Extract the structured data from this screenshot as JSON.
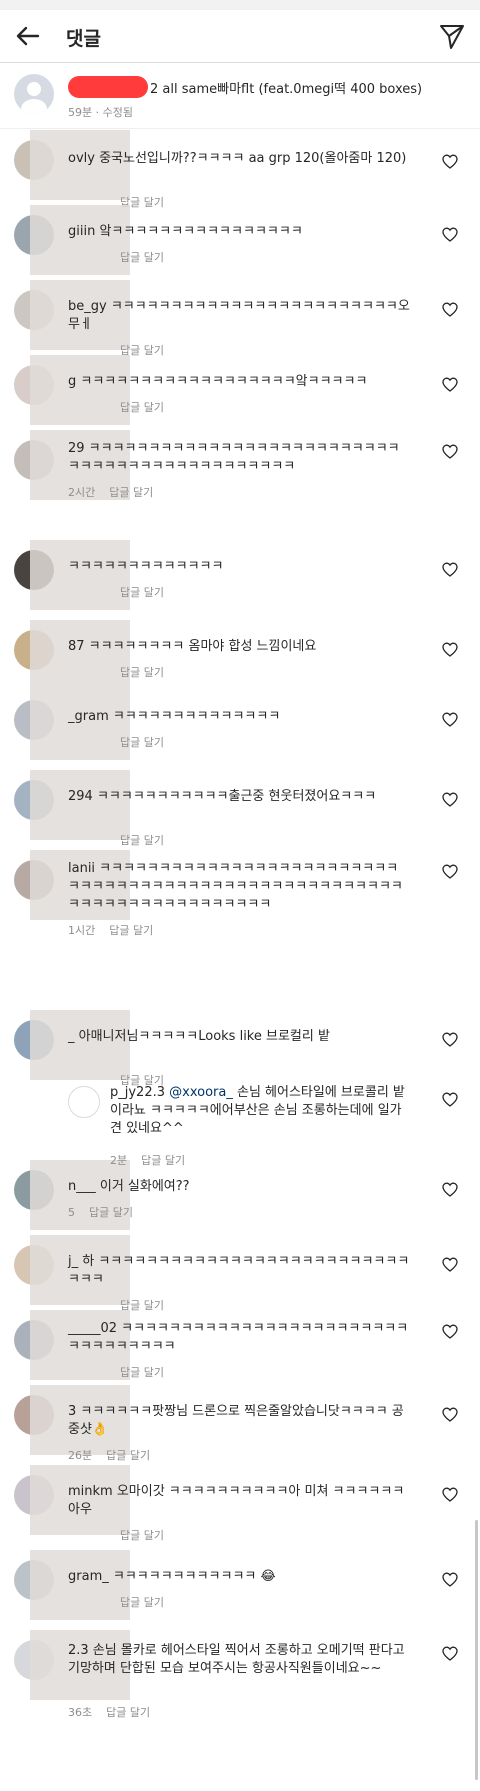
{
  "header": {
    "title": "댓글"
  },
  "caption": {
    "text": "2 all same빠마flt (feat.0megi떡 400 boxes)",
    "meta": "59분 · 수정됨"
  },
  "reply_label": "답글 달기",
  "comments": [
    {
      "text": "ovly 중국노선입니까??ㅋㅋㅋㅋ aa grp 120(올아줌마 120)",
      "time": ""
    },
    {
      "text": "giiin 앜ㅋㅋㅋㅋㅋㅋㅋㅋㅋㅋㅋㅋㅋㅋㅋㅋ",
      "time": ""
    },
    {
      "text": "be_gy ㅋㅋㅋㅋㅋㅋㅋㅋㅋㅋㅋㅋㅋㅋㅋㅋㅋㅋㅋㅋㅋㅋㅋㅋ오무ㅔ",
      "time": ""
    },
    {
      "text": "g ㅋㅋㅋㅋㅋㅋㅋㅋㅋㅋㅋㅋㅋㅋㅋㅋㅋㅋ앜ㅋㅋㅋㅋㅋ",
      "time": ""
    },
    {
      "text": "29 ㅋㅋㅋㅋㅋㅋㅋㅋㅋㅋㅋㅋㅋㅋㅋㅋㅋㅋㅋㅋㅋㅋㅋㅋㅋㅋㅋㅋㅋㅋㅋㅋㅋㅋㅋㅋㅋㅋㅋㅋㅋㅋㅋㅋㅋ",
      "time": "2시간"
    },
    {
      "text": "ㅋㅋㅋㅋㅋㅋㅋㅋㅋㅋㅋㅋㅋ",
      "time": ""
    },
    {
      "text": "87 ㅋㅋㅋㅋㅋㅋㅋㅋ 옴마야 합성 느낌이네요",
      "time": ""
    },
    {
      "text": "_gram ㅋㅋㅋㅋㅋㅋㅋㅋㅋㅋㅋㅋㅋㅋ",
      "time": ""
    },
    {
      "text": "294 ㅋㅋㅋㅋㅋㅋㅋㅋㅋㅋㅋ출근중 현웃터졌어요ㅋㅋㅋ",
      "time": ""
    },
    {
      "text": "lanii ㅋㅋㅋㅋㅋㅋㅋㅋㅋㅋㅋㅋㅋㅋㅋㅋㅋㅋㅋㅋㅋㅋㅋㅋㅋㅋㅋㅋㅋㅋㅋㅋㅋㅋㅋㅋㅋㅋㅋㅋㅋㅋㅋㅋㅋㅋㅋㅋㅋㅋㅋㅋㅋㅋㅋㅋㅋㅋㅋㅋㅋㅋㅋㅋㅋㅋㅋㅋㅋㅋ",
      "time": "1시간"
    },
    {
      "text": "_ 아매니저님ㅋㅋㅋㅋㅋLooks like 브로컬리 밭",
      "time": ""
    },
    {
      "text": "n___ 이거 실화에여??",
      "time": "5"
    },
    {
      "text": "j_ 하 ㅋㅋㅋㅋㅋㅋㅋㅋㅋㅋㅋㅋㅋㅋㅋㅋㅋㅋㅋㅋㅋㅋㅋㅋㅋㅋㅋㅋㅋ",
      "time": ""
    },
    {
      "text": "_____02 ㅋㅋㅋㅋㅋㅋㅋㅋㅋㅋㅋㅋㅋㅋㅋㅋㅋㅋㅋㅋㅋㅋㅋㅋㅋㅋㅋㅋㅋㅋㅋㅋㅋ",
      "time": ""
    },
    {
      "text": "3 ㅋㅋㅋㅋㅋㅋ팟짱님 드론으로 찍은줄알았습니닷ㅋㅋㅋㅋ 공중샷👌",
      "time": "26분"
    },
    {
      "text": "minkm 오마이갓 ㅋㅋㅋㅋㅋㅋㅋㅋㅋㅋ아 미쳐 ㅋㅋㅋㅋㅋㅋ아우",
      "time": ""
    },
    {
      "text": "gram_ ㅋㅋㅋㅋㅋㅋㅋㅋㅋㅋㅋㅋ 😂",
      "time": ""
    },
    {
      "text": "2.3 손님 몰카로 헤어스타일 찍어서 조롱하고 오메기떡 판다고 기망하며 단합된 모습 보여주시는 항공사직원들이네요~~",
      "time": "36초"
    }
  ],
  "reply": {
    "author": "p_jy22.3",
    "mention": "@xxoora_",
    "text": " 손님 헤어스타일에 브로콜리 밭이라뇨 ㅋㅋㅋㅋㅋ에어부산은 손님 조롱하는데에 일가견 있네요^^",
    "time": "2분"
  }
}
